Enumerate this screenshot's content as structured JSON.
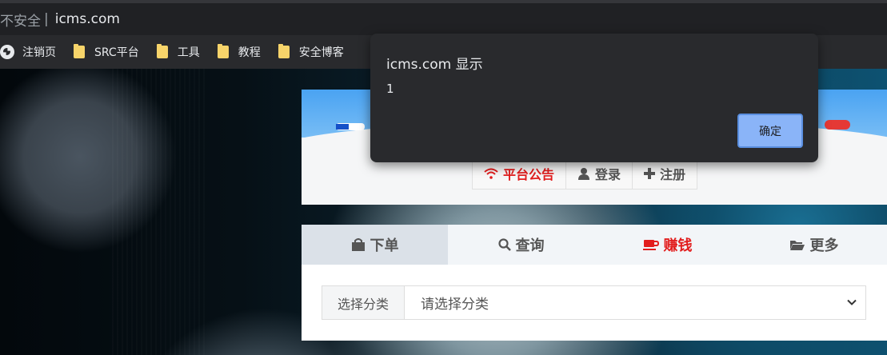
{
  "browser": {
    "security_label": "不安全",
    "separator": "|",
    "url": "icms.com"
  },
  "bookmarks": [
    {
      "label": "注销页",
      "icon": "globe-icon"
    },
    {
      "label": "SRC平台",
      "icon": "folder-icon"
    },
    {
      "label": "工具",
      "icon": "folder-icon"
    },
    {
      "label": "教程",
      "icon": "folder-icon"
    },
    {
      "label": "安全博客",
      "icon": "folder-icon"
    }
  ],
  "site": {
    "nav": [
      {
        "label": "平台公告",
        "icon": "wifi-icon",
        "color": "#e21d1d"
      },
      {
        "label": "登录",
        "icon": "user-icon"
      },
      {
        "label": "注册",
        "icon": "plus-icon"
      }
    ],
    "tabs": [
      {
        "label": "下单",
        "icon": "shopping-bag-icon",
        "active": true
      },
      {
        "label": "查询",
        "icon": "search-icon"
      },
      {
        "label": "赚钱",
        "icon": "coffee-cup-icon",
        "color": "#e21d1d"
      },
      {
        "label": "更多",
        "icon": "folder-open-icon"
      }
    ],
    "category": {
      "label": "选择分类",
      "placeholder": "请选择分类"
    }
  },
  "alert": {
    "title": "icms.com 显示",
    "message": "1",
    "ok_label": "确定",
    "accent": "#8ab4f8"
  }
}
